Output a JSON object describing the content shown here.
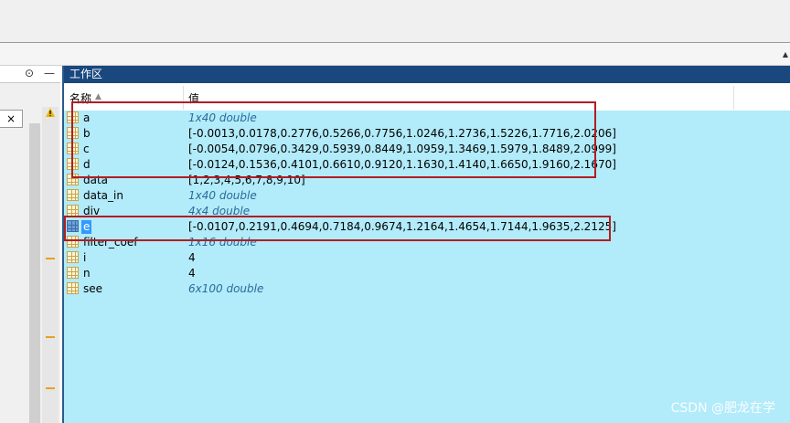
{
  "workspace": {
    "title": "工作区",
    "columns": {
      "name": "名称",
      "value": "值"
    },
    "variables": [
      {
        "name": "a",
        "value": "1x40 double",
        "italic": true
      },
      {
        "name": "b",
        "value": "[-0.0013,0.0178,0.2776,0.5266,0.7756,1.0246,1.2736,1.5226,1.7716,2.0206]",
        "italic": false
      },
      {
        "name": "c",
        "value": "[-0.0054,0.0796,0.3429,0.5939,0.8449,1.0959,1.3469,1.5979,1.8489,2.0999]",
        "italic": false
      },
      {
        "name": "d",
        "value": "[-0.0124,0.1536,0.4101,0.6610,0.9120,1.1630,1.4140,1.6650,1.9160,2.1670]",
        "italic": false
      },
      {
        "name": "data",
        "value": "[1,2,3,4,5,6,7,8,9,10]",
        "italic": false
      },
      {
        "name": "data_in",
        "value": "1x40 double",
        "italic": true
      },
      {
        "name": "div",
        "value": "4x4 double",
        "italic": true
      },
      {
        "name": "e",
        "value": "[-0.0107,0.2191,0.4694,0.7184,0.9674,1.2164,1.4654,1.7144,1.9635,2.2125]",
        "italic": false,
        "selected": true
      },
      {
        "name": "filter_coef",
        "value": "1x16 double",
        "italic": true
      },
      {
        "name": "i",
        "value": "4",
        "italic": false
      },
      {
        "name": "n",
        "value": "4",
        "italic": false
      },
      {
        "name": "see",
        "value": "6x100 double",
        "italic": true
      }
    ]
  },
  "left_panel": {
    "close_label": "×"
  },
  "watermark": "CSDN @肥龙在学",
  "colors": {
    "title_bar": "#19477e",
    "body": "#b2ebfa",
    "highlight": "#b21d22",
    "selected": "#3399ff"
  }
}
